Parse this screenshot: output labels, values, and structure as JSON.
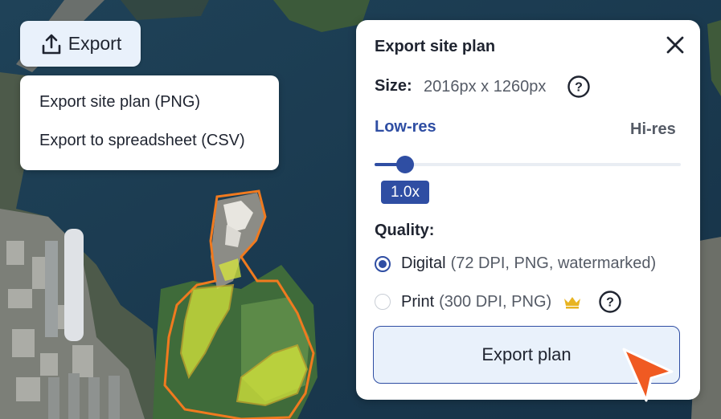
{
  "toolbar": {
    "export_label": "Export"
  },
  "export_menu": {
    "items": [
      {
        "label": "Export site plan (PNG)"
      },
      {
        "label": "Export to spreadsheet (CSV)"
      }
    ]
  },
  "panel": {
    "title": "Export site plan",
    "size_label": "Size:",
    "size_value": "2016px x 1260px",
    "resolution": {
      "low_label": "Low-res",
      "high_label": "Hi-res",
      "value_label": "1.0x",
      "slider_fraction": 0.1
    },
    "quality_label": "Quality:",
    "options": [
      {
        "main": "Digital",
        "sub": "(72 DPI, PNG, watermarked)",
        "selected": true
      },
      {
        "main": "Print",
        "sub": "(300 DPI, PNG)",
        "selected": false,
        "badge": "crown-icon"
      }
    ],
    "export_button": "Export plan"
  },
  "colors": {
    "accent": "#2f4ea3",
    "button_bg": "#e9f1fb",
    "cursor": "#f05a22",
    "water": "#1b3a52",
    "site_outline": "#f07a1f",
    "site_fill": "#d8e83a"
  }
}
